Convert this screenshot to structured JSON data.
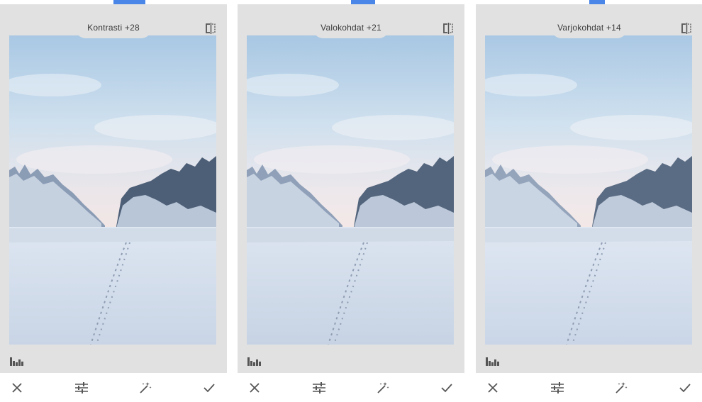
{
  "panels": [
    {
      "adjustment_label": "Kontrasti +28",
      "adjustment_value": 28,
      "actions": {
        "cancel": "close-icon",
        "tune": "tune-icon",
        "auto": "magic-wand-icon",
        "apply": "check-icon"
      }
    },
    {
      "adjustment_label": "Valokohdat +21",
      "adjustment_value": 21,
      "actions": {
        "cancel": "close-icon",
        "tune": "tune-icon",
        "auto": "magic-wand-icon",
        "apply": "check-icon"
      }
    },
    {
      "adjustment_label": "Varjokohdat +14",
      "adjustment_value": 14,
      "actions": {
        "cancel": "close-icon",
        "tune": "tune-icon",
        "auto": "magic-wand-icon",
        "apply": "check-icon"
      }
    }
  ],
  "colors": {
    "accent": "#4a86e8",
    "editor_background": "#e1e1e1",
    "icon": "#555555"
  }
}
